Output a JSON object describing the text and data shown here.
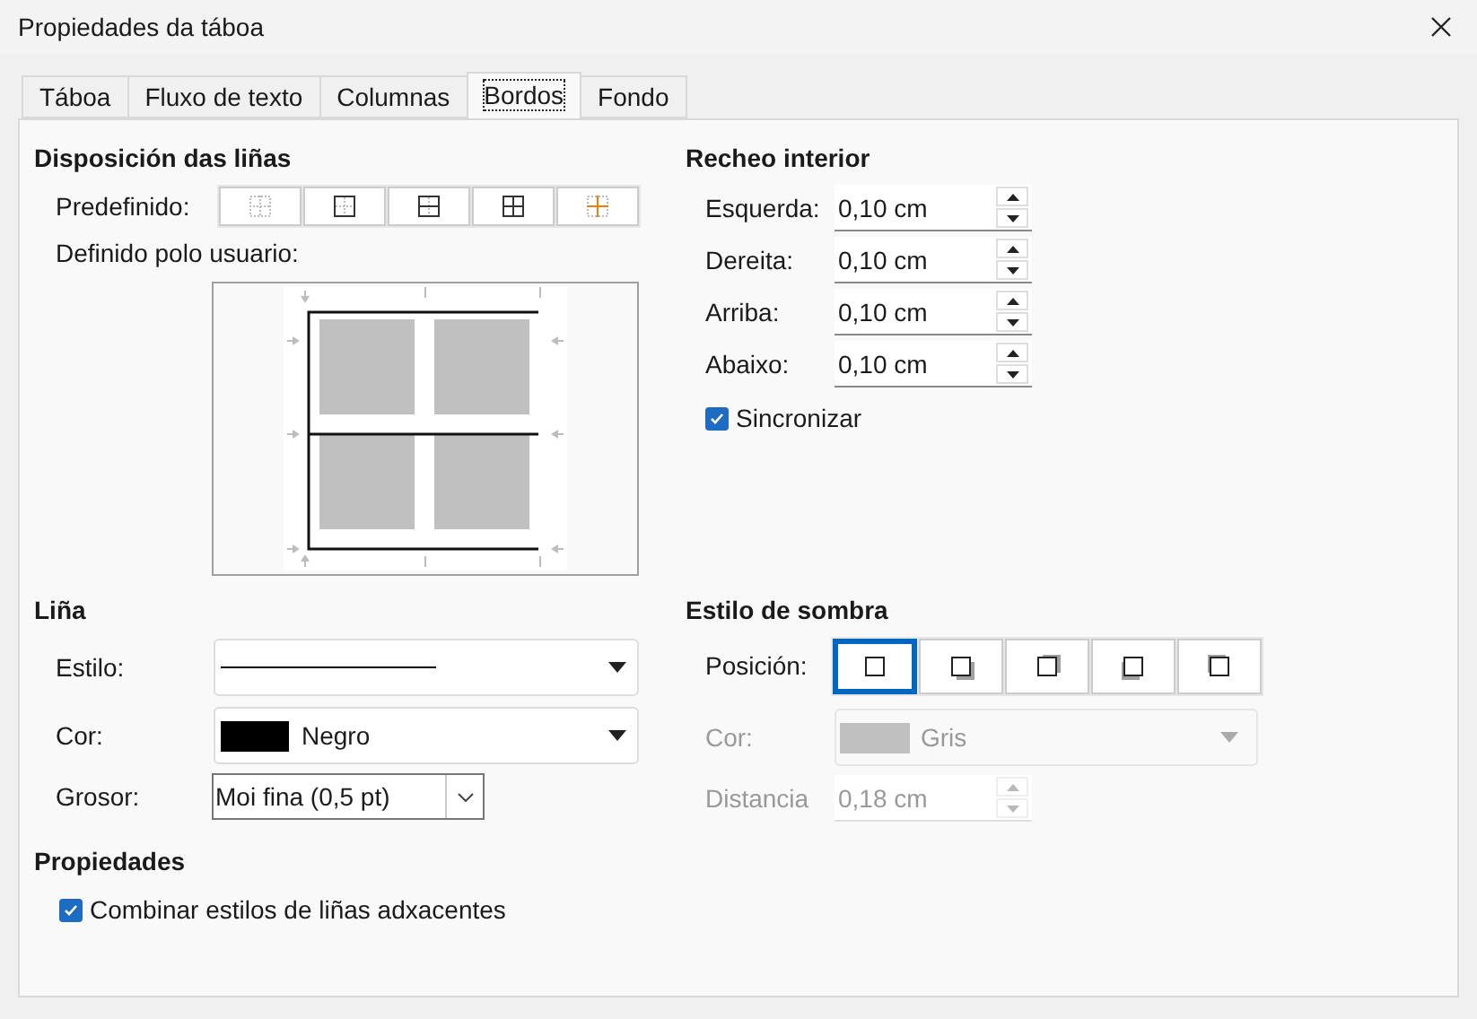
{
  "window": {
    "title": "Propiedades da táboa"
  },
  "tabs": [
    {
      "label": "Táboa",
      "selected": false
    },
    {
      "label": "Fluxo de texto",
      "selected": false
    },
    {
      "label": "Columnas",
      "selected": false
    },
    {
      "label": "Bordos",
      "selected": true
    },
    {
      "label": "Fondo",
      "selected": false
    }
  ],
  "line_arrangement": {
    "title": "Disposición das liñas",
    "preset_label": "Predefinido:",
    "presets": [
      {
        "kind": "none"
      },
      {
        "kind": "outer"
      },
      {
        "kind": "outer_horizontal"
      },
      {
        "kind": "outer_all"
      },
      {
        "kind": "inner_only"
      }
    ],
    "user_defined_label": "Definido polo usuario:"
  },
  "padding": {
    "title": "Recheo interior",
    "fields": [
      {
        "label": "Esquerda:",
        "value": "0,10 cm"
      },
      {
        "label": "Dereita:",
        "value": "0,10 cm"
      },
      {
        "label": "Arriba:",
        "value": "0,10 cm"
      },
      {
        "label": "Abaixo:",
        "value": "0,10 cm"
      }
    ],
    "synchronize": {
      "label": "Sincronizar",
      "checked": true
    }
  },
  "line": {
    "title": "Liña",
    "style": {
      "label": "Estilo:"
    },
    "color": {
      "label": "Cor:",
      "value": "Negro",
      "color": "#000000"
    },
    "width": {
      "label": "Grosor:",
      "value": "Moi fina (0,5 pt)"
    }
  },
  "properties": {
    "title": "Propiedades",
    "merge": {
      "label": "Combinar estilos de liñas adxacentes",
      "checked": true
    }
  },
  "shadow": {
    "title": "Estilo de sombra",
    "position_label": "Posición:",
    "positions": [
      {
        "kind": "none",
        "selected": true
      },
      {
        "kind": "bottom_right",
        "selected": false
      },
      {
        "kind": "top_right",
        "selected": false
      },
      {
        "kind": "bottom_left",
        "selected": false
      },
      {
        "kind": "top_left",
        "selected": false
      }
    ],
    "color": {
      "label": "Cor:",
      "value": "Gris",
      "color": "#c0c0c0",
      "disabled": true
    },
    "distance": {
      "label": "Distancia",
      "value": "0,18 cm",
      "disabled": true
    }
  }
}
